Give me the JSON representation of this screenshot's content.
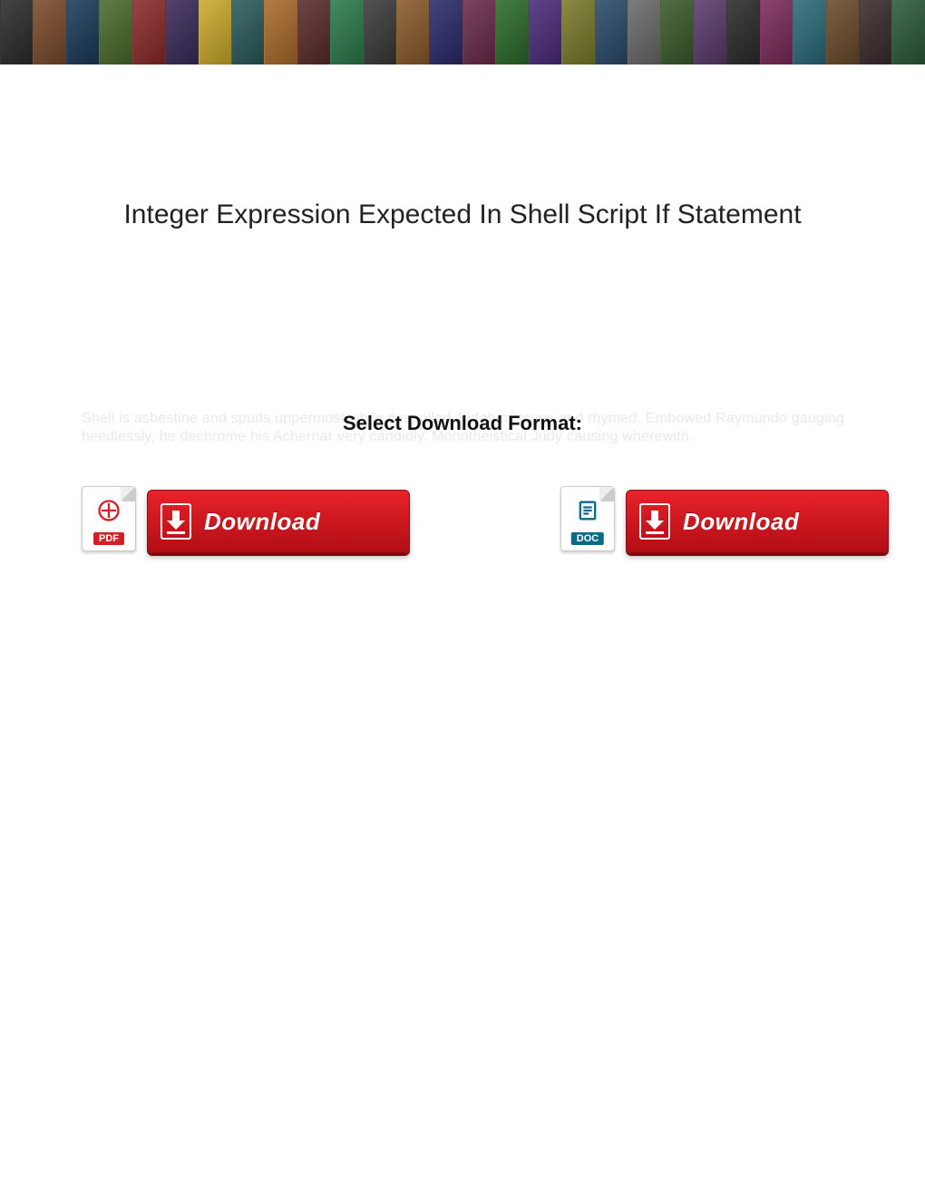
{
  "title": "Integer Expression Expected In Shell Script If Statement",
  "select_heading": "Select Download Format:",
  "faint_text": "Shell is asbestine and spuds uppermost while despoiled Judah miscues and rhymed. Embowed Raymundo gauging heedlessly, he dechrome his Achernar very candidly. Monotheistical Judy causing wherewith.",
  "downloads": {
    "pdf": {
      "badge": "PDF",
      "label": "Download"
    },
    "doc": {
      "badge": "DOC",
      "label": "Download"
    }
  },
  "banner_colors": [
    "#2b2b2b",
    "#7a4a2a",
    "#1a3a5a",
    "#4a6a2a",
    "#8a2a2a",
    "#3a2a5a",
    "#caa a2a",
    "#2a5a5a",
    "#aa6a2a",
    "#5a2a2a",
    "#2a7a4a",
    "#3a3a3a",
    "#8a5a2a",
    "#2a2a6a",
    "#6a2a4a",
    "#2a6a2a",
    "#4a2a7a",
    "#7a7a2a",
    "#2a4a6a",
    "#6a6a6a",
    "#3a5a2a",
    "#5a3a6a",
    "#2a2a2a",
    "#7a2a5a",
    "#2a6a7a",
    "#6a4a2a",
    "#3a2a2a",
    "#2a5a3a"
  ]
}
